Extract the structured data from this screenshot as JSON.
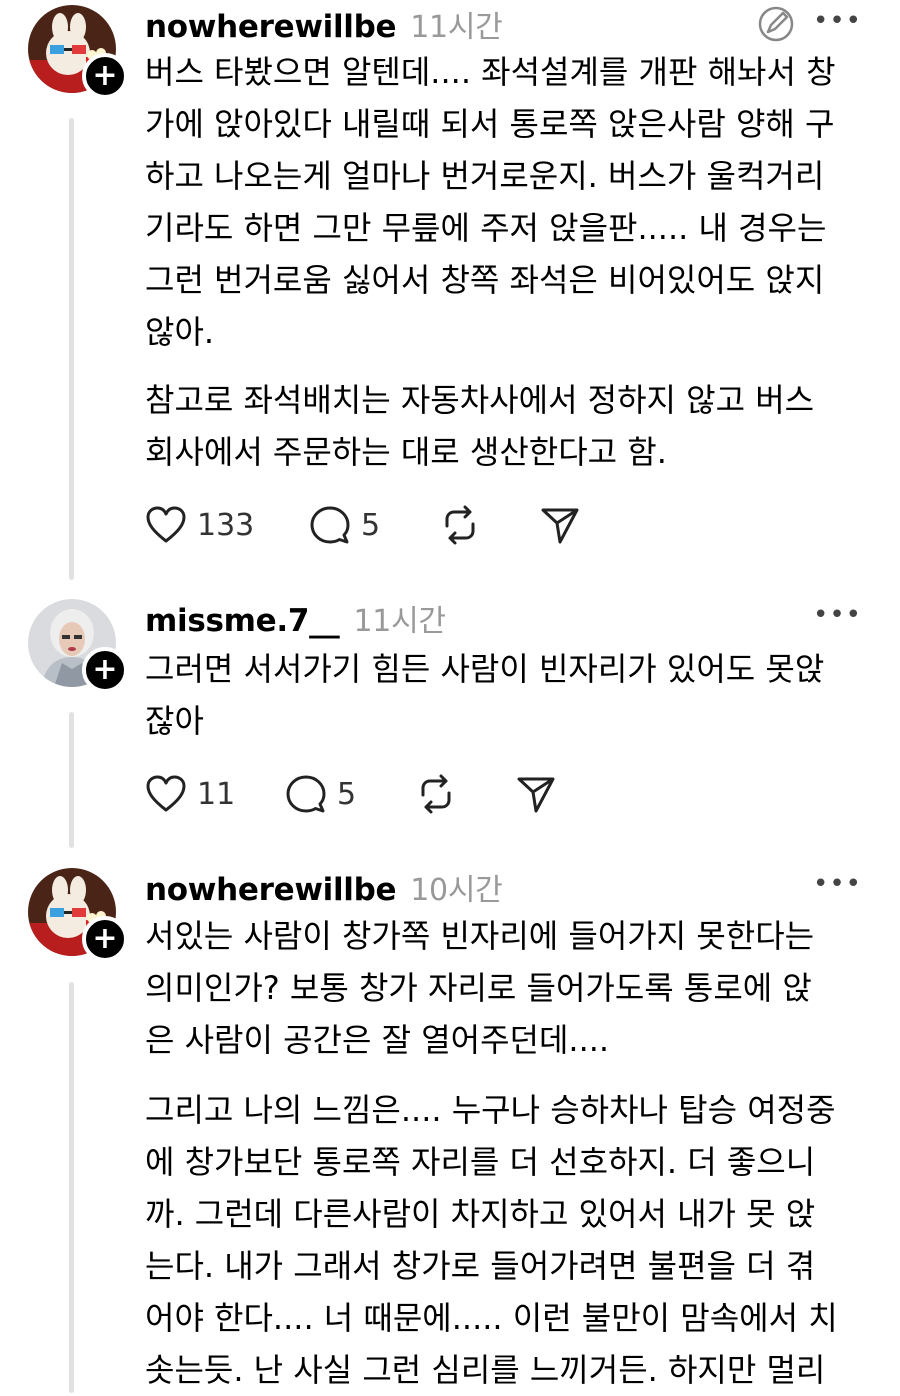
{
  "comments": [
    {
      "username": "nowherewillbe",
      "time": "11시간",
      "paragraphs": [
        [
          "버스 타봤으면 알텐데.... 좌석설계를 개판 해놔서 창",
          "가에 앉아있다 내릴때 되서 통로쪽 앉은사람 양해 구",
          "하고 나오는게 얼마나 번거로운지. 버스가 울컥거리",
          "기라도 하면 그만 무릎에 주저 앉을판..... 내 경우는",
          "그런 번거로움 싫어서 창쪽 좌석은 비어있어도 앉지",
          "않아."
        ],
        [
          "참고로 좌석배치는 자동차사에서 정하지 않고 버스",
          "회사에서 주문하는 대로 생산한다고 함."
        ]
      ],
      "likes": "133",
      "replies": "5"
    },
    {
      "username": "missme.7__",
      "time": "11시간",
      "paragraphs": [
        [
          "그러면 서서가기 힘든 사람이 빈자리가 있어도 못앉",
          "잖아"
        ]
      ],
      "likes": "11",
      "replies": "5"
    },
    {
      "username": "nowherewillbe",
      "time": "10시간",
      "paragraphs": [
        [
          "서있는 사람이 창가쪽 빈자리에 들어가지 못한다는",
          "의미인가? 보통 창가 자리로 들어가도록 통로에 앉",
          "은 사람이 공간은 잘 열어주던데...."
        ],
        [
          "그리고 나의 느낌은.... 누구나 승하차나 탑승 여정중",
          "에 창가보단 통로쪽 자리를 더 선호하지. 더 좋으니",
          "까. 그런데 다른사람이 차지하고 있어서 내가 못 앉",
          "는다. 내가 그래서 창가로 들어가려면 불편을 더 겪",
          "어야 한다.... 너 때문에..... 이런 불만이 맘속에서 치",
          "솟는듯. 난 사실 그런 심리를 느끼거든. 하지만 멀리"
        ]
      ]
    }
  ],
  "icons": {
    "like": "heart-icon",
    "reply": "comment-icon",
    "repost": "repost-icon",
    "share": "send-icon",
    "more": "more-icon",
    "follow": "plus-icon"
  },
  "glyphs": {
    "more": "•••",
    "plus": "+"
  }
}
